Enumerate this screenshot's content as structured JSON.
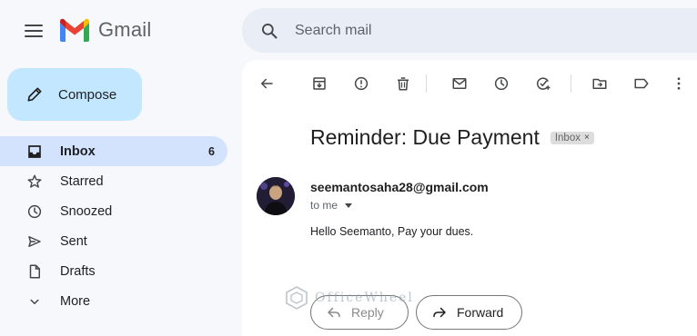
{
  "app": {
    "name": "Gmail"
  },
  "colors": {
    "accent": "#0b57d0",
    "compose_bg": "#c2e7ff",
    "active_nav_bg": "#d3e3fd",
    "canvas_bg": "#f6f8fc"
  },
  "header": {
    "menu_icon": "hamburger-menu-icon",
    "logo_icon": "gmail-m-logo",
    "search": {
      "icon": "search-icon",
      "placeholder": "Search mail"
    }
  },
  "compose": {
    "label": "Compose",
    "icon": "pencil-icon"
  },
  "sidebar": {
    "items": [
      {
        "label": "Inbox",
        "icon": "inbox-icon",
        "count": "6",
        "active": true
      },
      {
        "label": "Starred",
        "icon": "star-icon",
        "count": ""
      },
      {
        "label": "Snoozed",
        "icon": "clock-icon",
        "count": ""
      },
      {
        "label": "Sent",
        "icon": "send-icon",
        "count": ""
      },
      {
        "label": "Drafts",
        "icon": "draft-file-icon",
        "count": ""
      },
      {
        "label": "More",
        "icon": "chevron-down-icon",
        "count": ""
      }
    ]
  },
  "toolbar": {
    "buttons": [
      "back-arrow-icon",
      "archive-icon",
      "report-spam-icon",
      "delete-icon",
      "mark-unread-icon",
      "snooze-icon",
      "add-to-tasks-icon",
      "move-to-icon",
      "label-icon",
      "more-vert-icon"
    ]
  },
  "email": {
    "subject": "Reminder: Due Payment",
    "label_chip": {
      "text": "Inbox",
      "close": "×"
    },
    "sender": "seemantosaha28@gmail.com",
    "recipient": "to me",
    "body": "Hello Seemanto, Pay your dues.",
    "avatar_icon": "sender-avatar-photo"
  },
  "actions": {
    "reply": {
      "label": "Reply",
      "icon": "reply-arrow-icon"
    },
    "forward": {
      "label": "Forward",
      "icon": "forward-arrow-icon"
    }
  },
  "watermark": {
    "text": "OfficeWheel",
    "icon": "officewheel-logo"
  }
}
